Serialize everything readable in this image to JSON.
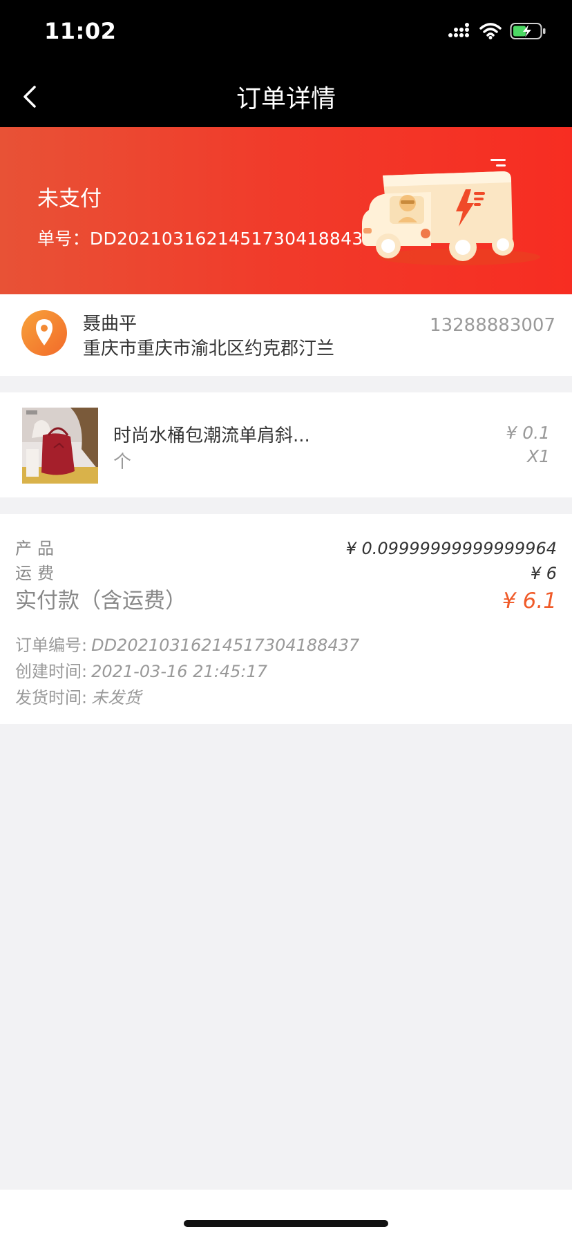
{
  "status_bar": {
    "time": "11:02"
  },
  "nav": {
    "title": "订单详情"
  },
  "banner": {
    "status": "未支付",
    "order_line": "单号：DD20210316214517304188437"
  },
  "address": {
    "name": "聂曲平",
    "detail": "重庆市重庆市渝北区约克郡汀兰",
    "phone": "13288883007"
  },
  "product": {
    "name": "时尚水桶包潮流单肩斜...",
    "unit": "个",
    "price": "¥ 0.1",
    "qty": "X1"
  },
  "summary": {
    "product_label": "产品",
    "product_value": "¥ 0.09999999999999964",
    "shipping_label": "运费",
    "shipping_value": "¥ 6",
    "total_label": "实付款（含运费）",
    "total_value": "¥ 6.1",
    "order_no_label": "订单编号:",
    "order_no_value": "DD20210316214517304188437",
    "created_label": "创建时间:",
    "created_value": "2021-03-16 21:45:17",
    "shipped_label": "发货时间:",
    "shipped_value": "未发货"
  },
  "colors": {
    "accent": "#f05a28",
    "banner_start": "#e85236",
    "banner_end": "#f72d22"
  },
  "icons": {
    "back": "chevron-left-icon",
    "location": "location-pin-icon",
    "truck": "delivery-truck-illustration"
  }
}
